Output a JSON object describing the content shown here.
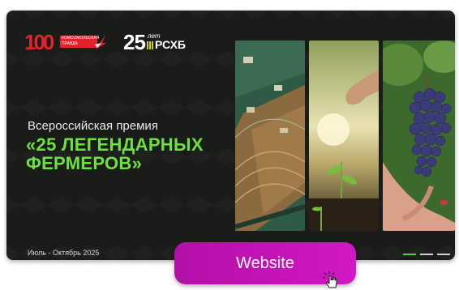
{
  "logos": {
    "kp_number": "100",
    "kp_text": "КОМСОМОЛЬСКАЯ ПРАВДА",
    "anniv_number": "25",
    "anniv_word": "лет",
    "anniv_brand": "РСХБ"
  },
  "award": {
    "subtitle": "Всероссийская премия",
    "title_line1": "«25 ЛЕГЕНДАРНЫХ",
    "title_line2": "ФЕРМЕРОВ»",
    "date": "Июль - Октябрь 2025"
  },
  "colors": {
    "title_green": "#6ee23c",
    "button_magenta": "#c013b6",
    "brand_red": "#e2232b",
    "card_bg": "#1a1c1a"
  },
  "slider": {
    "total": 3,
    "active_index": 0
  },
  "cta": {
    "label": "Website",
    "icon": "pointer-hand-icon"
  }
}
